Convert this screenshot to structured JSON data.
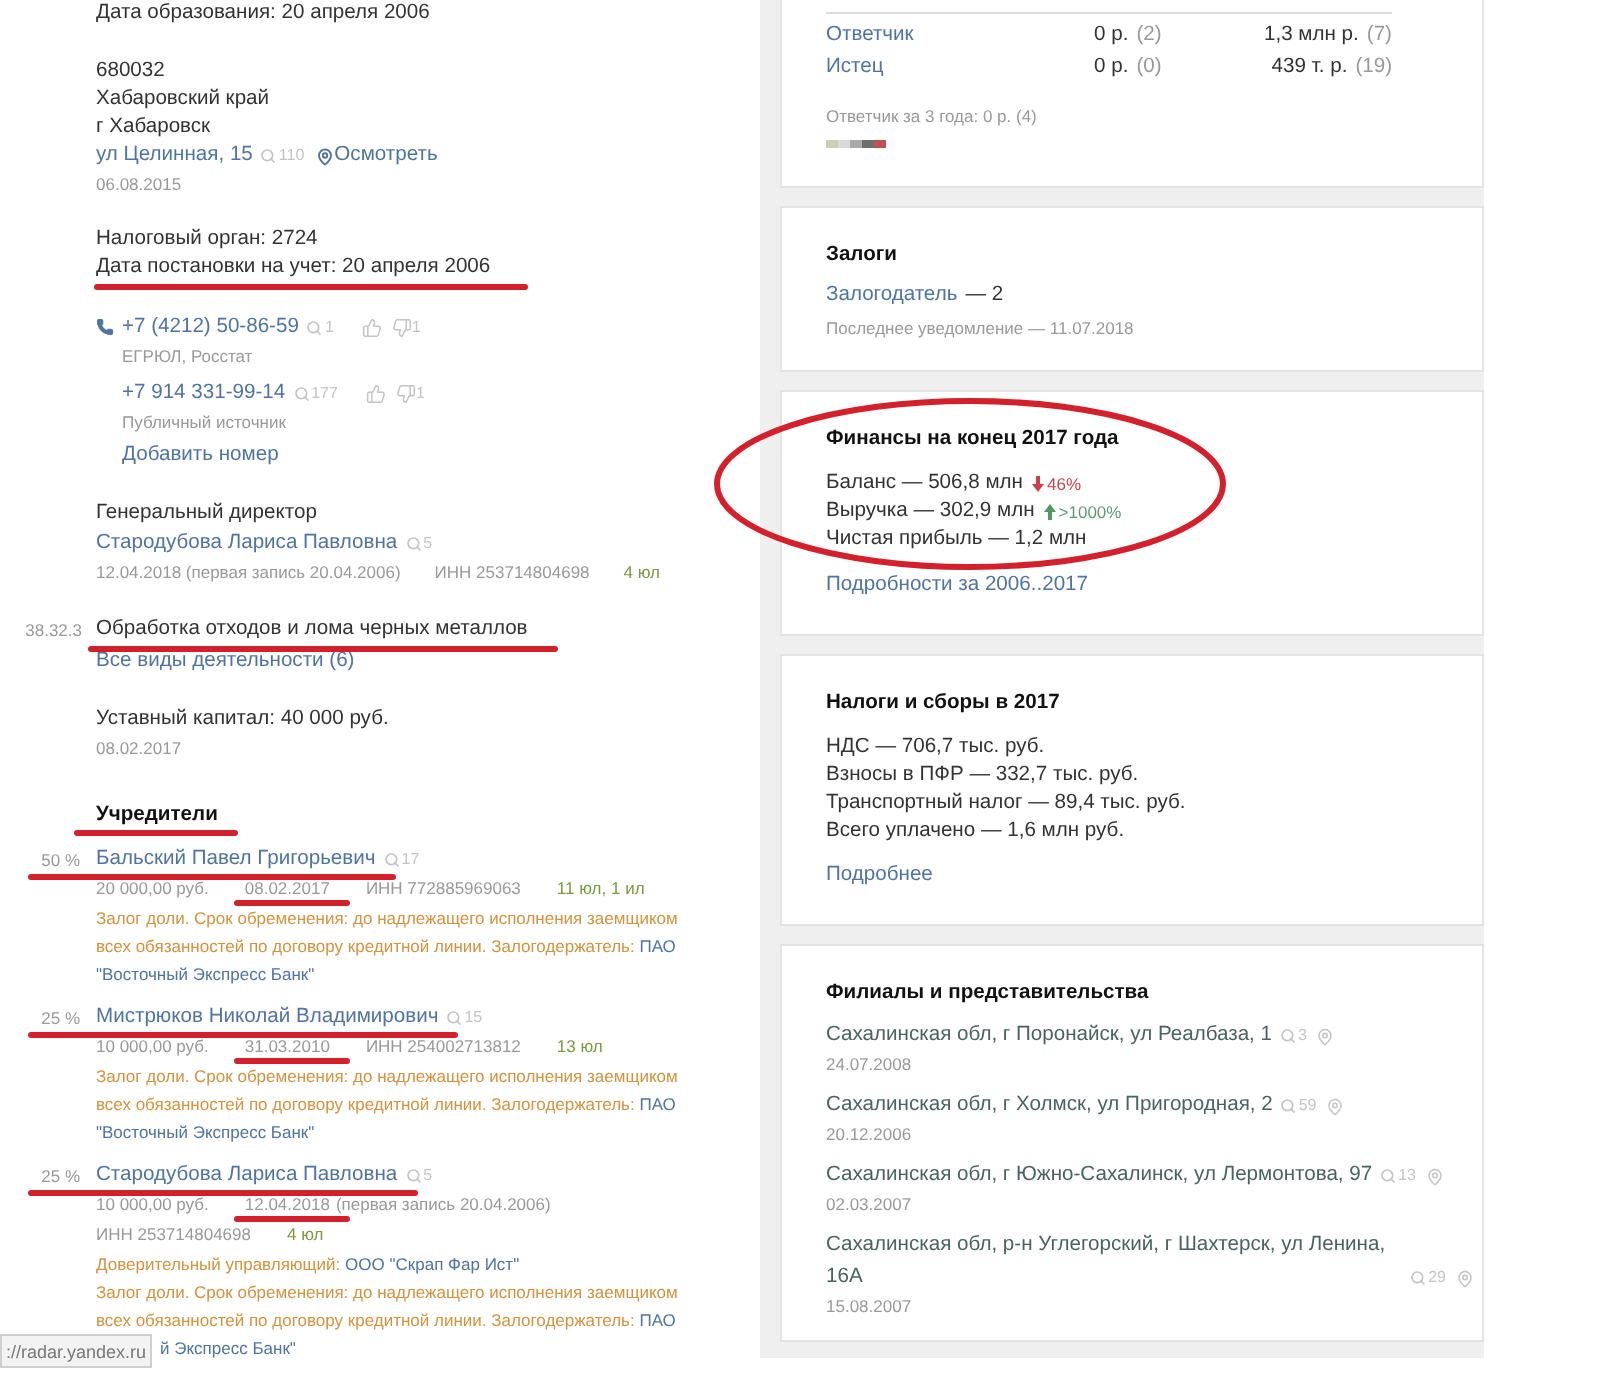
{
  "left": {
    "registration_date": "Дата образования: 20 апреля 2006",
    "address": {
      "lines": [
        "680032",
        "Хабаровский край",
        "г Хабаровск"
      ],
      "street": "ул Целинная, 15",
      "views": "110",
      "map_link": "Осмотреть",
      "date": "06.08.2015"
    },
    "tax": {
      "authority": "Налоговый орган: 2724",
      "registered": "Дата постановки на учет: 20 апреля 2006",
      "underlined": true
    },
    "phones": [
      {
        "number": "+7 (4212) 50-86-59",
        "views": "1",
        "dislikes": "1",
        "source": "ЕГРЮЛ, Росстат",
        "with_icon": true
      },
      {
        "number": "+7 914 331-99-14",
        "views": "177",
        "dislikes": "1",
        "source": "Публичный источник",
        "with_icon": false
      }
    ],
    "add_phone": "Добавить номер",
    "director": {
      "role": "Генеральный директор",
      "name": "Стародубова Лариса Павловна",
      "views": "5",
      "date": "12.04.2018 (первая запись 20.04.2006)",
      "inn": "ИНН 253714804698",
      "links": "4 юл"
    },
    "activity": {
      "code": "38.32.3",
      "name": "Обработка отходов и лома черных металлов",
      "underlined": true,
      "all_link": "Все виды деятельности (6)"
    },
    "capital": {
      "text": "Уставный капитал: 40 000 руб.",
      "date": "08.02.2017"
    },
    "founders_title": {
      "text": "Учредители",
      "underlined": true
    },
    "founders": [
      {
        "share": "50 %",
        "name": "Бальский Павел Григорьевич",
        "views": "17",
        "underlined": true,
        "capital": "20 000,00 руб.",
        "date": "08.02.2017",
        "date_underlined": true,
        "inn": "ИНН 772885969063",
        "links": "11 юл, 1 ил",
        "pledge": {
          "text": "Залог доли. Срок обременения: до надлежащего исполнения заемщиком всех обязанностей по договору кредитной линии. Залогодержатель:",
          "holder": [
            "ПАО",
            "\"Восточный Экспресс Банк\""
          ]
        }
      },
      {
        "share": "25 %",
        "name": "Мистрюков Николай Владимирович",
        "views": "15",
        "underlined": true,
        "capital": "10 000,00 руб.",
        "date": "31.03.2010",
        "date_underlined": true,
        "inn": "ИНН 254002713812",
        "links": "13 юл",
        "pledge": {
          "text": "Залог доли. Срок обременения: до надлежащего исполнения заемщиком всех обязанностей по договору кредитной линии. Залогодержатель:",
          "holder": [
            "ПАО",
            "\"Восточный Экспресс Банк\""
          ]
        }
      },
      {
        "share": "25 %",
        "name": "Стародубова Лариса Павловна",
        "views": "5",
        "underlined": true,
        "capital": "10 000,00 руб.",
        "date": "12.04.2018",
        "date_note": "(первая запись 20.04.2006)",
        "date_underlined": true,
        "inn": "ИНН 253714804698",
        "links": "4 юл",
        "trustee": {
          "label": "Доверительный управляющий:",
          "name": "ООО \"Скрап Фар Ист\""
        },
        "pledge": {
          "text": "Залог доли. Срок обременения: до надлежащего исполнения заемщиком всех обязанностей по договору кредитной линии. Залогодержатель:",
          "holder": [
            "ПАО"
          ],
          "cut_line": "й Экспресс Банк\""
        }
      }
    ]
  },
  "right": {
    "court": {
      "rows": [
        {
          "label": "Ответчик",
          "col_2": {
            "amount": "0 р.",
            "count": "(2)"
          },
          "col_3": {
            "amount": "1,3 млн р.",
            "count": "(7)"
          }
        },
        {
          "label": "Истец",
          "col_2": {
            "amount": "0 р.",
            "count": "(0)"
          },
          "col_3": {
            "amount": "439 т. р.",
            "count": "(19)"
          }
        }
      ],
      "summary": "Ответчик за 3 года: 0 р. (4)"
    },
    "pledges": {
      "title": "Залоги",
      "link": "Залогодатель",
      "value": "— 2",
      "note": "Последнее уведомление — 11.07.2018"
    },
    "finance": {
      "title": "Финансы на конец 2017 года",
      "circled": true,
      "rows": [
        {
          "text": "Баланс — 506,8 млн",
          "change": "46%",
          "rising": false
        },
        {
          "text": "Выручка — 302,9 млн",
          "change": ">1000%",
          "rising": true
        },
        {
          "text": "Чистая прибыль — 1,2 млн"
        }
      ],
      "link": "Подробности за 2006..2017"
    },
    "taxes": {
      "title": "Налоги и сборы в 2017",
      "rows": [
        "НДС — 706,7 тыс. руб.",
        "Взносы в ПФР — 332,7 тыс. руб.",
        "Транспортный налог — 89,4 тыс. руб.",
        "Всего уплачено — 1,6 млн руб."
      ],
      "link": "Подробнее"
    },
    "branches": {
      "title": "Филиалы и представительства",
      "items": [
        {
          "address": "Сахалинская обл, г Поронайск, ул Реалбаза, 1",
          "views": "3",
          "date": "24.07.2008"
        },
        {
          "address": "Сахалинская обл, г Холмск, ул Пригородная, 2",
          "views": "59",
          "date": "20.12.2006"
        },
        {
          "address": "Сахалинская обл, г Южно-Сахалинск, ул Лермонтова, 97",
          "views": "13",
          "date": "02.03.2007"
        },
        {
          "address": "Сахалинская обл, р-н Углегорский, г Шахтерск, ул Ленина, 16А",
          "views": "29",
          "date": "15.08.2007"
        }
      ]
    }
  },
  "status_bar": {
    "url": "://radar.yandex.ru"
  }
}
